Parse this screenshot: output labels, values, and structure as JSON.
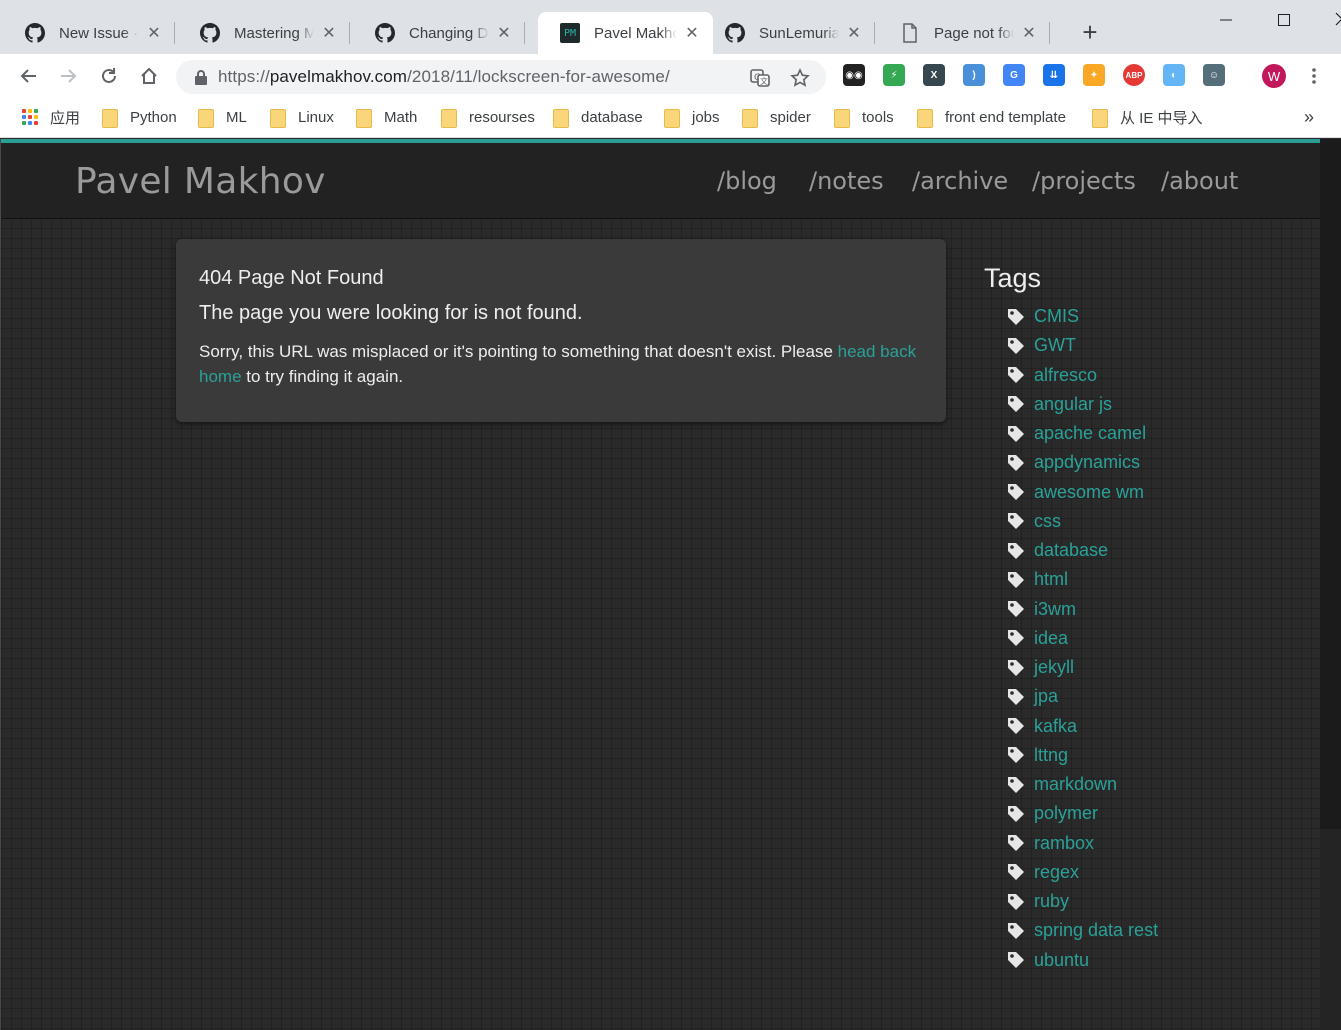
{
  "browser": {
    "tabs": [
      {
        "title": "New Issue · str",
        "favicon": "github-icon",
        "active": false
      },
      {
        "title": "Mastering Mar",
        "favicon": "github-icon",
        "active": false
      },
      {
        "title": "Changing Disc",
        "favicon": "github-icon",
        "active": false
      },
      {
        "title": "Pavel Makhov",
        "favicon": "pm-logo-icon",
        "active": true
      },
      {
        "title": "SunLemuria/in",
        "favicon": "github-icon",
        "active": false
      },
      {
        "title": "Page not foun",
        "favicon": "page-icon",
        "active": false
      }
    ],
    "new_tab_label": "+",
    "url": {
      "scheme": "https://",
      "host": "pavelmakhov.com",
      "path": "/2018/11/lockscreen-for-awesome/"
    },
    "profile_initial": "W",
    "bookmarks": [
      {
        "label": "应用",
        "icon": "apps-grid-icon"
      },
      {
        "label": "Python",
        "icon": "folder-icon"
      },
      {
        "label": "ML",
        "icon": "folder-icon"
      },
      {
        "label": "Linux",
        "icon": "folder-icon"
      },
      {
        "label": "Math",
        "icon": "folder-icon"
      },
      {
        "label": "resourses",
        "icon": "folder-icon"
      },
      {
        "label": "database",
        "icon": "folder-icon"
      },
      {
        "label": "jobs",
        "icon": "folder-icon"
      },
      {
        "label": "spider",
        "icon": "folder-icon"
      },
      {
        "label": "tools",
        "icon": "folder-icon"
      },
      {
        "label": "front end template",
        "icon": "folder-icon"
      },
      {
        "label": "从 IE 中导入",
        "icon": "folder-icon"
      }
    ],
    "bookmarks_overflow": "»",
    "extensions": [
      {
        "name": "spy-icon",
        "color": "#222222",
        "text": "◉◉"
      },
      {
        "name": "colorful-icon",
        "color": "#34a853",
        "text": "⚡"
      },
      {
        "name": "x-icon",
        "color": "#37474f",
        "text": "X"
      },
      {
        "name": "swirl-icon",
        "color": "#4a90d9",
        "text": ")"
      },
      {
        "name": "translate-icon",
        "color": "#4285f4",
        "text": "G"
      },
      {
        "name": "pocket-icon",
        "color": "#1a73e8",
        "text": "⇊"
      },
      {
        "name": "fire-icon",
        "color": "#f9a825",
        "text": "✦"
      },
      {
        "name": "adblock-icon",
        "color": "#e53935",
        "text": "ABP"
      },
      {
        "name": "globe-icon",
        "color": "#64b5f6",
        "text": "◐"
      },
      {
        "name": "octocat-icon",
        "color": "#546e7a",
        "text": "☺"
      }
    ]
  },
  "site": {
    "brand": "Pavel Makhov",
    "nav": [
      "/blog",
      "/notes",
      "/archive",
      "/projects",
      "/about"
    ],
    "accent": "#2aa198"
  },
  "error": {
    "title": "404 Page Not Found",
    "subtitle": "The page you were looking for is not found.",
    "message_before": "Sorry, this URL was misplaced or it's pointing to something that doesn't exist. Please ",
    "link_text": "head back home",
    "message_after": " to try finding it again."
  },
  "tags": {
    "heading": "Tags",
    "items": [
      "CMIS",
      "GWT",
      "alfresco",
      "angular js",
      "apache camel",
      "appdynamics",
      "awesome wm",
      "css",
      "database",
      "html",
      "i3wm",
      "idea",
      "jekyll",
      "jpa",
      "kafka",
      "lttng",
      "markdown",
      "polymer",
      "rambox",
      "regex",
      "ruby",
      "spring data rest",
      "ubuntu"
    ]
  }
}
